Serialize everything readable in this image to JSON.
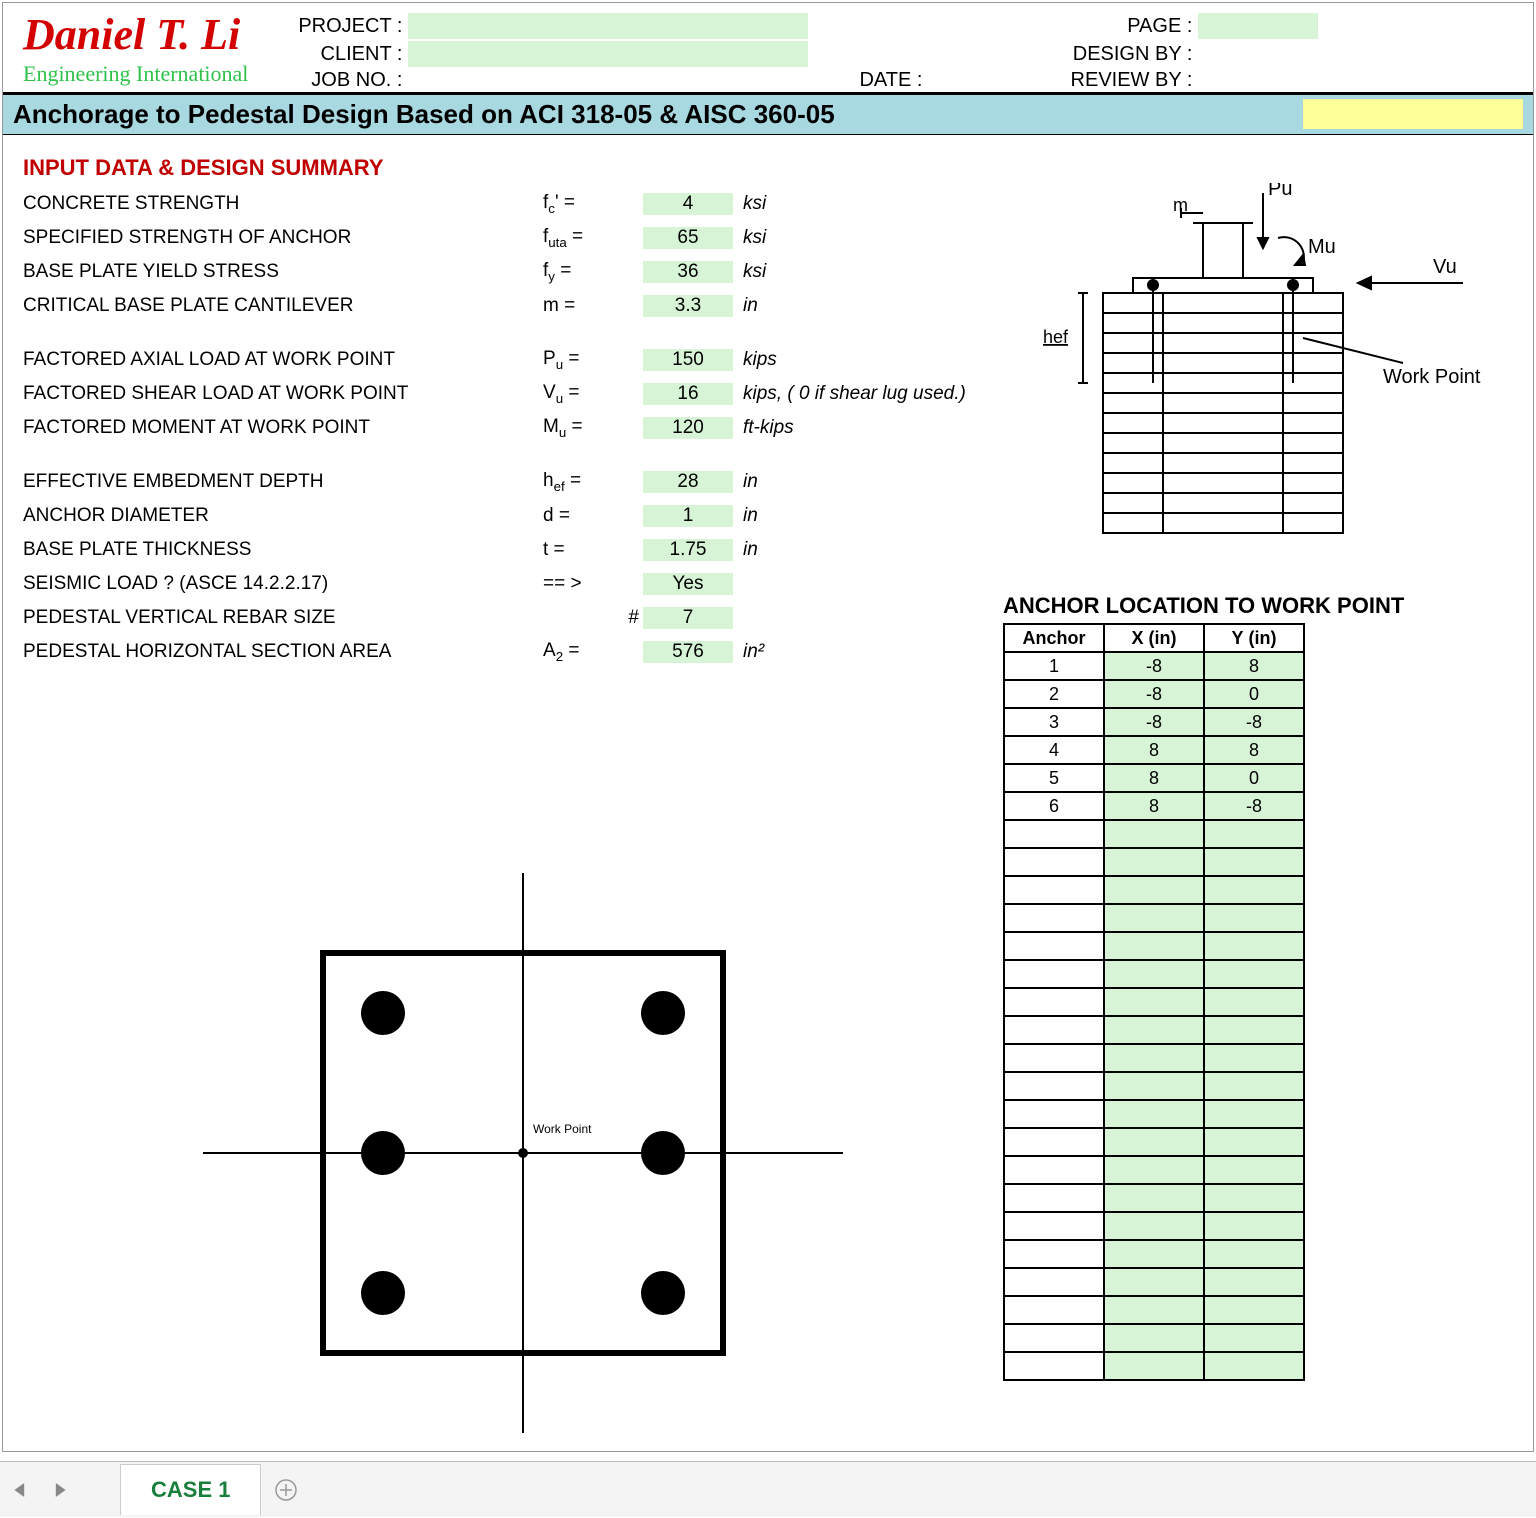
{
  "brand": {
    "name": "Daniel T. Li",
    "sub": "Engineering International"
  },
  "header": {
    "project_lbl": "PROJECT :",
    "project_val": "",
    "client_lbl": "CLIENT :",
    "client_val": "",
    "jobno_lbl": "JOB NO. :",
    "jobno_val": "",
    "date_lbl": "DATE :",
    "date_val": "",
    "page_lbl": "PAGE :",
    "page_val": "",
    "designby_lbl": "DESIGN BY :",
    "designby_val": "",
    "reviewby_lbl": "REVIEW BY :",
    "reviewby_val": ""
  },
  "title": "Anchorage to Pedestal Design Based on ACI 318-05 & AISC 360-05",
  "section1": "INPUT DATA & DESIGN SUMMARY",
  "inputs": [
    {
      "desc": "CONCRETE STRENGTH",
      "sym": "f_c' =",
      "pre": "",
      "val": "4",
      "unit": "ksi"
    },
    {
      "desc": "SPECIFIED STRENGTH OF ANCHOR",
      "sym": "f_uta =",
      "pre": "",
      "val": "65",
      "unit": "ksi"
    },
    {
      "desc": "BASE PLATE YIELD STRESS",
      "sym": "f_y =",
      "pre": "",
      "val": "36",
      "unit": "ksi"
    },
    {
      "desc": "CRITICAL BASE PLATE CANTILEVER",
      "sym": "m =",
      "pre": "",
      "val": "3.3",
      "unit": "in"
    }
  ],
  "loads": [
    {
      "desc": "FACTORED AXIAL LOAD AT WORK POINT",
      "sym": "P_u =",
      "pre": "",
      "val": "150",
      "unit": "kips"
    },
    {
      "desc": "FACTORED SHEAR LOAD AT WORK POINT",
      "sym": "V_u =",
      "pre": "",
      "val": "16",
      "unit": "kips, ( 0 if shear lug used.)"
    },
    {
      "desc": "FACTORED MOMENT AT WORK POINT",
      "sym": "M_u =",
      "pre": "",
      "val": "120",
      "unit": "ft-kips"
    }
  ],
  "geom": [
    {
      "desc": "EFFECTIVE EMBEDMENT DEPTH",
      "sym": "h_ef =",
      "pre": "",
      "val": "28",
      "unit": "in"
    },
    {
      "desc": "ANCHOR DIAMETER",
      "sym": "d =",
      "pre": "",
      "val": "1",
      "unit": "in"
    },
    {
      "desc": "BASE PLATE THICKNESS",
      "sym": "t =",
      "pre": "",
      "val": "1.75",
      "unit": "in"
    },
    {
      "desc": "SEISMIC LOAD ? (ASCE 14.2.2.17)",
      "sym": "== >",
      "pre": "",
      "val": "Yes",
      "unit": ""
    },
    {
      "desc": "PEDESTAL VERTICAL REBAR SIZE",
      "sym": "",
      "pre": "#",
      "val": "7",
      "unit": ""
    },
    {
      "desc": "PEDESTAL HORIZONTAL SECTION AREA",
      "sym": "A_2 =",
      "pre": "",
      "val": "576",
      "unit": "in²"
    }
  ],
  "anchor_title": "ANCHOR LOCATION TO WORK POINT",
  "anchor_headers": {
    "a": "Anchor",
    "x": "X (in)",
    "y": "Y (in)"
  },
  "anchors": [
    {
      "n": "1",
      "x": "-8",
      "y": "8"
    },
    {
      "n": "2",
      "x": "-8",
      "y": "0"
    },
    {
      "n": "3",
      "x": "-8",
      "y": "-8"
    },
    {
      "n": "4",
      "x": "8",
      "y": "8"
    },
    {
      "n": "5",
      "x": "8",
      "y": "0"
    },
    {
      "n": "6",
      "x": "8",
      "y": "-8"
    },
    {
      "n": "",
      "x": "",
      "y": ""
    },
    {
      "n": "",
      "x": "",
      "y": ""
    },
    {
      "n": "",
      "x": "",
      "y": ""
    },
    {
      "n": "",
      "x": "",
      "y": ""
    },
    {
      "n": "",
      "x": "",
      "y": ""
    },
    {
      "n": "",
      "x": "",
      "y": ""
    },
    {
      "n": "",
      "x": "",
      "y": ""
    },
    {
      "n": "",
      "x": "",
      "y": ""
    },
    {
      "n": "",
      "x": "",
      "y": ""
    },
    {
      "n": "",
      "x": "",
      "y": ""
    },
    {
      "n": "",
      "x": "",
      "y": ""
    },
    {
      "n": "",
      "x": "",
      "y": ""
    },
    {
      "n": "",
      "x": "",
      "y": ""
    },
    {
      "n": "",
      "x": "",
      "y": ""
    },
    {
      "n": "",
      "x": "",
      "y": ""
    },
    {
      "n": "",
      "x": "",
      "y": ""
    },
    {
      "n": "",
      "x": "",
      "y": ""
    },
    {
      "n": "",
      "x": "",
      "y": ""
    },
    {
      "n": "",
      "x": "",
      "y": ""
    },
    {
      "n": "",
      "x": "",
      "y": ""
    }
  ],
  "diagram_top": {
    "pu": "Pu",
    "m": "m",
    "mu": "Mu",
    "vu": "Vu",
    "hef": "hef",
    "wp": "Work  Point"
  },
  "plan": {
    "wp": "Work Point"
  },
  "tab": "CASE 1"
}
